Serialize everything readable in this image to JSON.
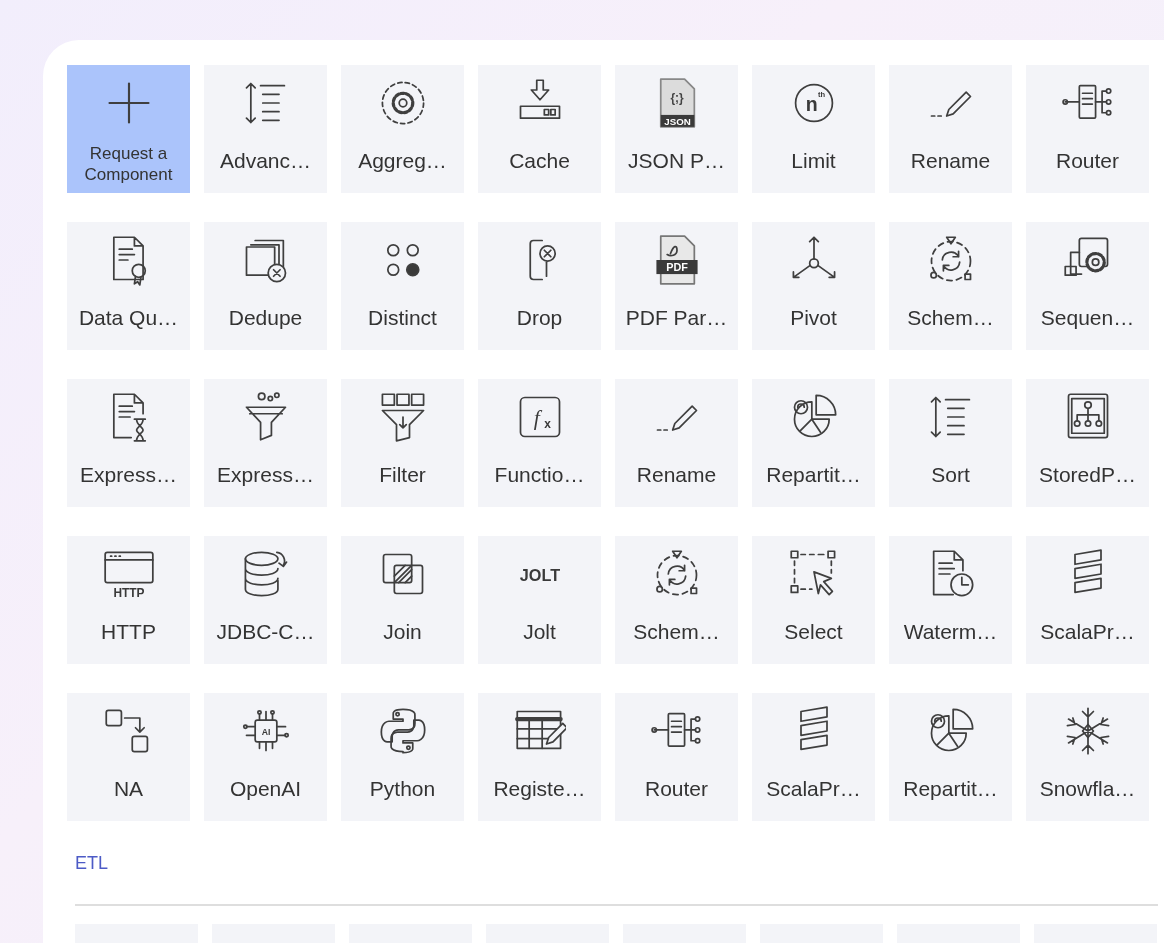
{
  "palette": {
    "components": [
      {
        "label": "Request a Component",
        "kind": "request",
        "selected": true
      },
      {
        "label": "Advanc…",
        "kind": "component",
        "selected": false
      },
      {
        "label": "Aggreg…",
        "kind": "component",
        "selected": false
      },
      {
        "label": "Cache",
        "kind": "component",
        "selected": false
      },
      {
        "label": "JSON P…",
        "kind": "component",
        "selected": false,
        "icon_texts": [
          "{;}",
          "JSON"
        ]
      },
      {
        "label": "Limit",
        "kind": "component",
        "selected": false,
        "icon_texts": [
          "n",
          "th"
        ]
      },
      {
        "label": "Rename",
        "kind": "component",
        "selected": false
      },
      {
        "label": "Router",
        "kind": "component",
        "selected": false
      },
      {
        "label": "Data Qu…",
        "kind": "component",
        "selected": false
      },
      {
        "label": "Dedupe",
        "kind": "component",
        "selected": false
      },
      {
        "label": "Distinct",
        "kind": "component",
        "selected": false
      },
      {
        "label": "Drop",
        "kind": "component",
        "selected": false
      },
      {
        "label": "PDF Par…",
        "kind": "component",
        "selected": false,
        "icon_texts": [
          "PDF"
        ]
      },
      {
        "label": "Pivot",
        "kind": "component",
        "selected": false
      },
      {
        "label": "Schem…",
        "kind": "component",
        "selected": false
      },
      {
        "label": "Sequen…",
        "kind": "component",
        "selected": false
      },
      {
        "label": "Express…",
        "kind": "component",
        "selected": false
      },
      {
        "label": "Express…",
        "kind": "component",
        "selected": false
      },
      {
        "label": "Filter",
        "kind": "component",
        "selected": false
      },
      {
        "label": "Functio…",
        "kind": "component",
        "selected": false,
        "icon_texts": [
          "f",
          "x"
        ]
      },
      {
        "label": "Rename",
        "kind": "component",
        "selected": false
      },
      {
        "label": "Repartit…",
        "kind": "component",
        "selected": false
      },
      {
        "label": "Sort",
        "kind": "component",
        "selected": false
      },
      {
        "label": "StoredP…",
        "kind": "component",
        "selected": false
      },
      {
        "label": "HTTP",
        "kind": "component",
        "selected": false,
        "icon_texts": [
          "HTTP"
        ]
      },
      {
        "label": "JDBC-C…",
        "kind": "component",
        "selected": false
      },
      {
        "label": "Join",
        "kind": "component",
        "selected": false
      },
      {
        "label": "Jolt",
        "kind": "component",
        "selected": false,
        "icon_texts": [
          "JOLT"
        ]
      },
      {
        "label": "Schem…",
        "kind": "component",
        "selected": false
      },
      {
        "label": "Select",
        "kind": "component",
        "selected": false
      },
      {
        "label": "Waterm…",
        "kind": "component",
        "selected": false
      },
      {
        "label": "ScalaPr…",
        "kind": "component",
        "selected": false
      },
      {
        "label": "NA",
        "kind": "component",
        "selected": false
      },
      {
        "label": "OpenAI",
        "kind": "component",
        "selected": false,
        "icon_texts": [
          "AI"
        ]
      },
      {
        "label": "Python",
        "kind": "component",
        "selected": false
      },
      {
        "label": "Registe…",
        "kind": "component",
        "selected": false
      },
      {
        "label": "Router",
        "kind": "component",
        "selected": false
      },
      {
        "label": "ScalaPr…",
        "kind": "component",
        "selected": false
      },
      {
        "label": "Repartit…",
        "kind": "component",
        "selected": false
      },
      {
        "label": "Snowfla…",
        "kind": "component",
        "selected": false
      }
    ],
    "section": {
      "title": "ETL"
    }
  }
}
